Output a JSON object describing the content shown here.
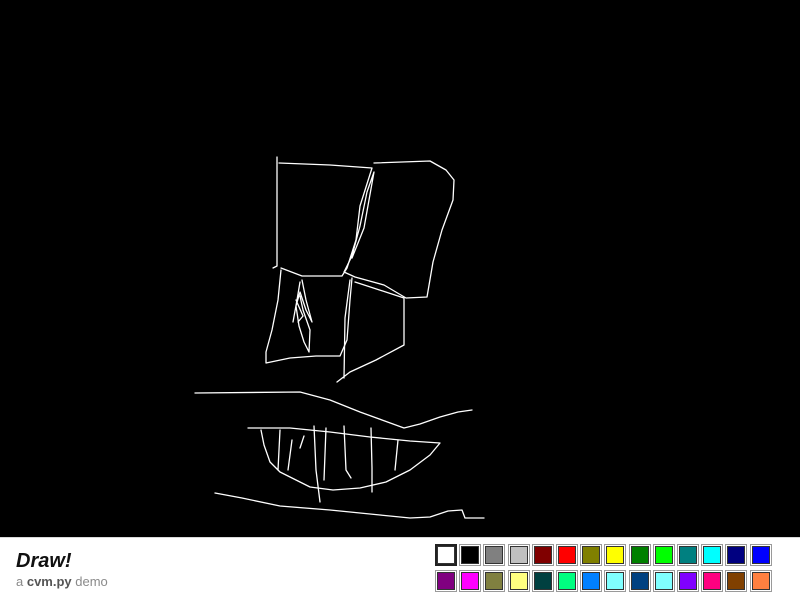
{
  "app": {
    "title": "Draw!",
    "subtitle_prefix": "a ",
    "subtitle_brand": "cvm.py",
    "subtitle_suffix": " demo"
  },
  "canvas": {
    "background": "#000000",
    "stroke_color": "#ffffff"
  },
  "palette": {
    "selected_index": 0,
    "rows": [
      [
        "#ffffff",
        "#000000",
        "#808080",
        "#c0c0c0",
        "#800000",
        "#ff0000",
        "#808000",
        "#ffff00",
        "#008000",
        "#00ff00",
        "#008080",
        "#00ffff",
        "#000080",
        "#0000ff"
      ],
      [
        "#800080",
        "#ff00ff",
        "#808040",
        "#ffff80",
        "#004040",
        "#00ff80",
        "#0080ff",
        "#80ffff",
        "#004080",
        "#80ffff",
        "#8000ff",
        "#ff0080",
        "#804000",
        "#ff8040"
      ]
    ]
  }
}
